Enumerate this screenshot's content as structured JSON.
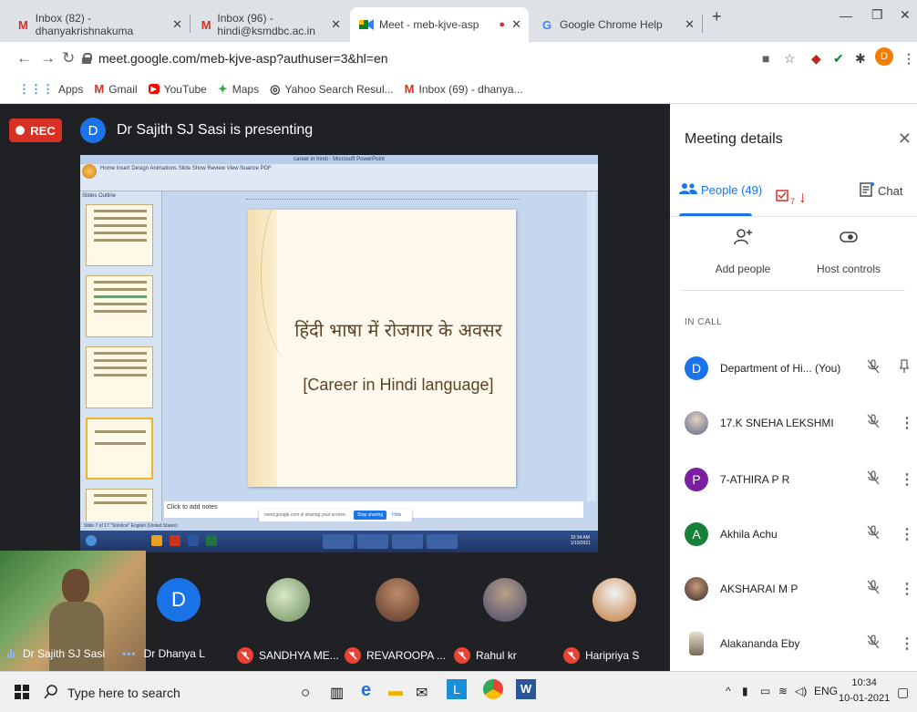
{
  "tabs": [
    {
      "title": "Inbox (82) - dhanyakrishnakuma",
      "icon": "gmail-icon"
    },
    {
      "title": "Inbox (96) - hindi@ksmdbc.ac.in",
      "icon": "gmail-icon"
    },
    {
      "title": "Meet - meb-kjve-asp",
      "icon": "meet-icon"
    },
    {
      "title": "Google Chrome Help",
      "icon": "google-icon"
    }
  ],
  "url": "meet.google.com/meb-kjve-asp?authuser=3&hl=en",
  "bookmarks": [
    "Apps",
    "Gmail",
    "YouTube",
    "Maps",
    "Yahoo Search Resul...",
    "Inbox (69) - dhanya..."
  ],
  "profile_letter": "D",
  "meet": {
    "rec_label": "REC",
    "presenter_letter": "D",
    "presenting_text": "Dr Sajith SJ Sasi is presenting"
  },
  "shared_screen": {
    "window_title": "career in hindi - Microsoft PowerPoint",
    "ribbon_tabs": "Home    Insert    Design    Animations    Slide Show    Review    View    Nuance PDF",
    "left_tabs": "Slides    Outline",
    "slide_hindi": "हिंदी भाषा में रोजगार के अवसर",
    "slide_english": "[Career in Hindi language]",
    "notes": "Click to add notes",
    "status": "Slide 7 of 17    \"Solstice\"    English (United States)",
    "share_msg": "meet.google.com is sharing your screen.",
    "stop_label": "Stop sharing",
    "hide_label": "Hide",
    "clock_time": "10:34 AM",
    "clock_date": "1/10/2021"
  },
  "self_tile": {
    "name": "Dr Sajith SJ Sasi"
  },
  "strip": [
    {
      "name": "Dr Dhanya L",
      "letter": "D",
      "color": "#1a73e8",
      "muted": false
    },
    {
      "name": "SANDHYA ME...",
      "letter": "",
      "color": "#5a7a4a",
      "muted": true
    },
    {
      "name": "REVAROOPA ...",
      "letter": "",
      "color": "#7a5a4a",
      "muted": true
    },
    {
      "name": "Rahul kr",
      "letter": "",
      "color": "#6a6a8a",
      "muted": true
    },
    {
      "name": "Haripriya S",
      "letter": "",
      "color": "#c07a3a",
      "muted": true
    }
  ],
  "panel": {
    "title": "Meeting details",
    "people_tab": "People (49)",
    "chat_tab": "Chat",
    "extra_badge": "7",
    "add_people": "Add people",
    "host_controls": "Host controls",
    "in_call": "IN CALL",
    "participants": [
      {
        "name": "Department of Hi...  (You)",
        "letter": "D",
        "color": "#1a73e8",
        "photo": false
      },
      {
        "name": "17.K SNEHA LEKSHMI",
        "letter": "",
        "color": "#8aa0b8",
        "photo": true
      },
      {
        "name": "7-ATHIRA P R",
        "letter": "P",
        "color": "#7b1fa2",
        "photo": false
      },
      {
        "name": "Akhila Achu",
        "letter": "A",
        "color": "#188038",
        "photo": false
      },
      {
        "name": "AKSHARAI M P",
        "letter": "",
        "color": "#6b4a3a",
        "photo": true
      },
      {
        "name": "Alakananda Eby",
        "letter": "",
        "color": "#9a8a6a",
        "photo": true
      }
    ]
  },
  "taskbar": {
    "search_placeholder": "Type here to search",
    "lang": "ENG",
    "time": "10:34",
    "date": "10-01-2021"
  },
  "colors": {
    "meet_bg": "#202124",
    "accent": "#1a73e8",
    "rec": "#d93025"
  }
}
